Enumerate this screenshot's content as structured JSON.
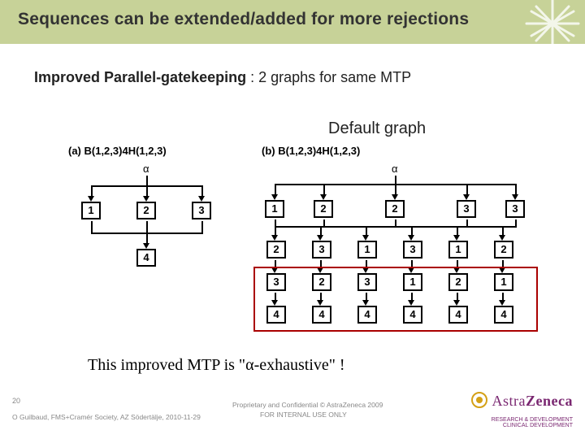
{
  "header": {
    "title": "Sequences can be extended/added for more rejections"
  },
  "subtitle": {
    "strong": "Improved Parallel-gatekeeping",
    "rest": " : 2 graphs for same MTP"
  },
  "default_label": "Default graph",
  "figure": {
    "a": {
      "label": "(a)  B(1,2,3)4H(1,2,3)",
      "alpha": "α",
      "row1": [
        "1",
        "2",
        "3"
      ],
      "row2": [
        "4"
      ]
    },
    "b": {
      "label": "(b)  B(1,2,3)4H(1,2,3)",
      "alpha": "α",
      "row1": [
        "1",
        "2",
        "2",
        "3",
        "3"
      ],
      "perms": [
        [
          "2",
          "3",
          "1",
          "3",
          "1",
          "2"
        ],
        [
          "3",
          "2",
          "3",
          "1",
          "2",
          "1"
        ],
        [
          "4",
          "4",
          "4",
          "4",
          "4",
          "4"
        ]
      ]
    }
  },
  "conclusion": {
    "pre": "This improved MTP is \"",
    "sym": "α",
    "post": "-exhaustive\" !"
  },
  "footer": {
    "page": "20",
    "credit": "O Guilbaud, FMS+Cramér Society, AZ Södertälje, 2010-11-29",
    "conf1": "Proprietary and Confidential © AstraZeneca 2009",
    "conf2": "FOR INTERNAL USE ONLY",
    "logo_a": "Astra",
    "logo_z": "Zeneca",
    "rd_l1": "RESEARCH & DEVELOPMENT",
    "rd_l2": "CLINICAL DEVELOPMENT"
  }
}
